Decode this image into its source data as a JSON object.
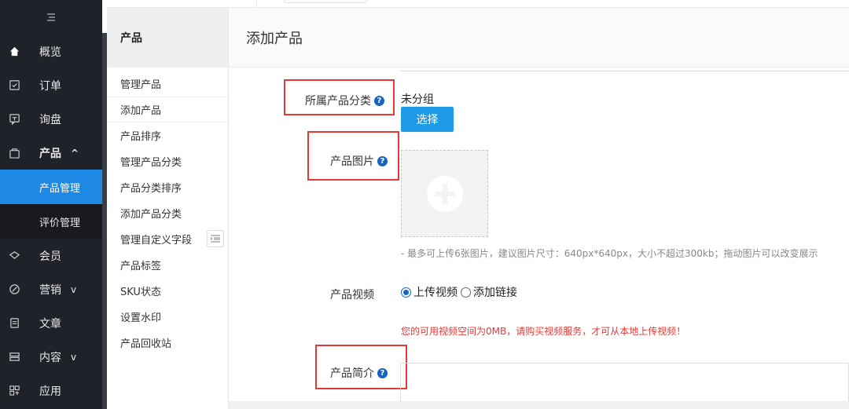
{
  "sidebar": {
    "toggle_icon": "menu-toggle-icon",
    "items": [
      {
        "label": "概览",
        "icon": "home-icon"
      },
      {
        "label": "订单",
        "icon": "order-icon"
      },
      {
        "label": "询盘",
        "icon": "inquiry-icon"
      },
      {
        "label": "产品",
        "icon": "bag-icon",
        "caret": "^"
      },
      {
        "label": "会员",
        "icon": "member-icon"
      },
      {
        "label": "营销",
        "icon": "marketing-icon",
        "caret": "v"
      },
      {
        "label": "文章",
        "icon": "article-icon"
      },
      {
        "label": "内容",
        "icon": "content-icon",
        "caret": "v"
      },
      {
        "label": "应用",
        "icon": "apps-icon"
      }
    ],
    "product_sub": [
      "产品管理",
      "评价管理"
    ]
  },
  "submenu": {
    "title": "产品",
    "items": [
      "管理产品",
      "添加产品",
      "产品排序",
      "管理产品分类",
      "产品分类排序",
      "添加产品分类",
      "管理自定义字段",
      "产品标签",
      "SKU状态",
      "设置水印",
      "产品回收站"
    ]
  },
  "main": {
    "title": "添加产品",
    "category": {
      "label": "所属产品分类",
      "value": "未分组",
      "button": "选择"
    },
    "image": {
      "label": "产品图片",
      "hint": "- 最多可上传6张图片，建议图片尺寸：640px*640px，大小不超过300kb；拖动图片可以改变展示"
    },
    "video": {
      "label": "产品视频",
      "option1": "上传视频",
      "option2": "添加链接",
      "warning": "您的可用视频空间为0MB，请购买视频服务，才可从本地上传视频！"
    },
    "intro": {
      "label": "产品简介"
    }
  },
  "colors": {
    "accent": "#1e88e5",
    "sidebar_bg": "#20222a",
    "highlight": "#e53935"
  }
}
